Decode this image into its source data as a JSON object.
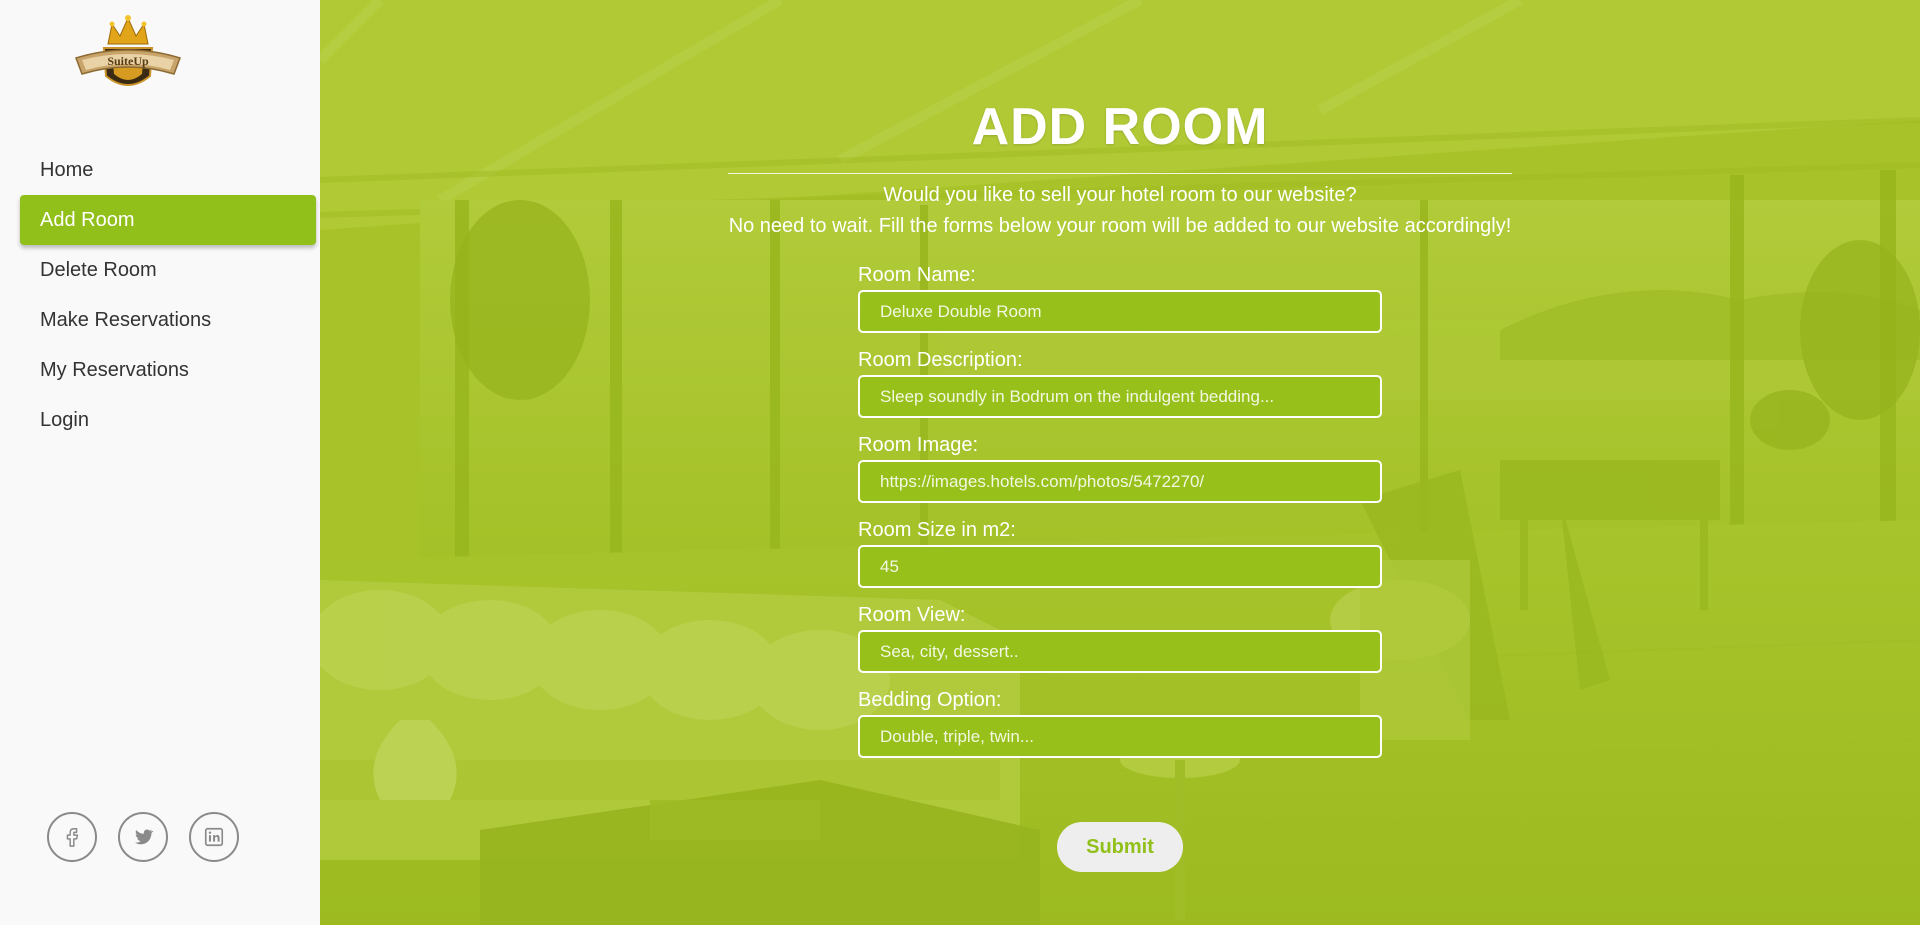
{
  "brand": {
    "logo_text": "SuiteUp"
  },
  "sidebar": {
    "items": [
      {
        "label": "Home"
      },
      {
        "label": "Add Room"
      },
      {
        "label": "Delete Room"
      },
      {
        "label": "Make Reservations"
      },
      {
        "label": "My Reservations"
      },
      {
        "label": "Login"
      }
    ],
    "active_item": "Add Room",
    "social": [
      "facebook-icon",
      "twitter-icon",
      "linkedin-icon"
    ]
  },
  "page": {
    "title": "ADD ROOM",
    "intro_line1": "Would you like to sell your hotel room to our website?",
    "intro_line2": "No need to wait. Fill the forms below your room will be added to our website accordingly!"
  },
  "form": {
    "room_name": {
      "label": "Room Name:",
      "placeholder": "Deluxe Double Room"
    },
    "room_description": {
      "label": "Room Description:",
      "placeholder": "Sleep soundly in Bodrum on the indulgent bedding..."
    },
    "room_image": {
      "label": "Room Image:",
      "placeholder": "https://images.hotels.com/photos/5472270/"
    },
    "room_size": {
      "label": "Room Size in m2:",
      "placeholder": "45"
    },
    "room_view": {
      "label": "Room View:",
      "placeholder": "Sea, city, dessert.."
    },
    "bedding_option": {
      "label": "Bedding Option:",
      "placeholder": "Double, triple, twin..."
    },
    "submit_label": "Submit"
  },
  "colors": {
    "accent": "#92c01a",
    "overlay": "#a9c52c",
    "sidebar_bg": "#f9f9f9",
    "nav_text": "#333333",
    "submit_bg": "#eeeeee"
  }
}
